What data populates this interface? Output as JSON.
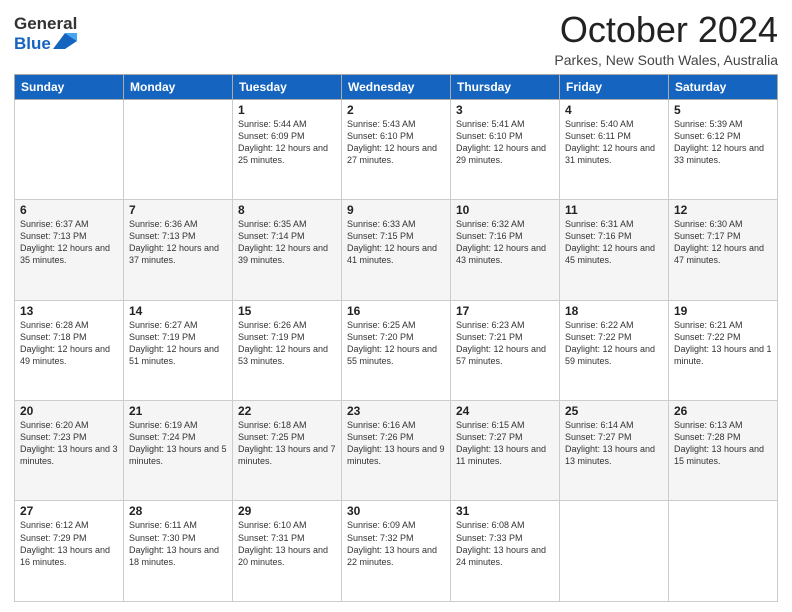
{
  "logo": {
    "general": "General",
    "blue": "Blue"
  },
  "title": {
    "month_year": "October 2024",
    "location": "Parkes, New South Wales, Australia"
  },
  "days_of_week": [
    "Sunday",
    "Monday",
    "Tuesday",
    "Wednesday",
    "Thursday",
    "Friday",
    "Saturday"
  ],
  "weeks": [
    [
      {
        "day": "",
        "info": ""
      },
      {
        "day": "",
        "info": ""
      },
      {
        "day": "1",
        "info": "Sunrise: 5:44 AM\nSunset: 6:09 PM\nDaylight: 12 hours and 25 minutes."
      },
      {
        "day": "2",
        "info": "Sunrise: 5:43 AM\nSunset: 6:10 PM\nDaylight: 12 hours and 27 minutes."
      },
      {
        "day": "3",
        "info": "Sunrise: 5:41 AM\nSunset: 6:10 PM\nDaylight: 12 hours and 29 minutes."
      },
      {
        "day": "4",
        "info": "Sunrise: 5:40 AM\nSunset: 6:11 PM\nDaylight: 12 hours and 31 minutes."
      },
      {
        "day": "5",
        "info": "Sunrise: 5:39 AM\nSunset: 6:12 PM\nDaylight: 12 hours and 33 minutes."
      }
    ],
    [
      {
        "day": "6",
        "info": "Sunrise: 6:37 AM\nSunset: 7:13 PM\nDaylight: 12 hours and 35 minutes."
      },
      {
        "day": "7",
        "info": "Sunrise: 6:36 AM\nSunset: 7:13 PM\nDaylight: 12 hours and 37 minutes."
      },
      {
        "day": "8",
        "info": "Sunrise: 6:35 AM\nSunset: 7:14 PM\nDaylight: 12 hours and 39 minutes."
      },
      {
        "day": "9",
        "info": "Sunrise: 6:33 AM\nSunset: 7:15 PM\nDaylight: 12 hours and 41 minutes."
      },
      {
        "day": "10",
        "info": "Sunrise: 6:32 AM\nSunset: 7:16 PM\nDaylight: 12 hours and 43 minutes."
      },
      {
        "day": "11",
        "info": "Sunrise: 6:31 AM\nSunset: 7:16 PM\nDaylight: 12 hours and 45 minutes."
      },
      {
        "day": "12",
        "info": "Sunrise: 6:30 AM\nSunset: 7:17 PM\nDaylight: 12 hours and 47 minutes."
      }
    ],
    [
      {
        "day": "13",
        "info": "Sunrise: 6:28 AM\nSunset: 7:18 PM\nDaylight: 12 hours and 49 minutes."
      },
      {
        "day": "14",
        "info": "Sunrise: 6:27 AM\nSunset: 7:19 PM\nDaylight: 12 hours and 51 minutes."
      },
      {
        "day": "15",
        "info": "Sunrise: 6:26 AM\nSunset: 7:19 PM\nDaylight: 12 hours and 53 minutes."
      },
      {
        "day": "16",
        "info": "Sunrise: 6:25 AM\nSunset: 7:20 PM\nDaylight: 12 hours and 55 minutes."
      },
      {
        "day": "17",
        "info": "Sunrise: 6:23 AM\nSunset: 7:21 PM\nDaylight: 12 hours and 57 minutes."
      },
      {
        "day": "18",
        "info": "Sunrise: 6:22 AM\nSunset: 7:22 PM\nDaylight: 12 hours and 59 minutes."
      },
      {
        "day": "19",
        "info": "Sunrise: 6:21 AM\nSunset: 7:22 PM\nDaylight: 13 hours and 1 minute."
      }
    ],
    [
      {
        "day": "20",
        "info": "Sunrise: 6:20 AM\nSunset: 7:23 PM\nDaylight: 13 hours and 3 minutes."
      },
      {
        "day": "21",
        "info": "Sunrise: 6:19 AM\nSunset: 7:24 PM\nDaylight: 13 hours and 5 minutes."
      },
      {
        "day": "22",
        "info": "Sunrise: 6:18 AM\nSunset: 7:25 PM\nDaylight: 13 hours and 7 minutes."
      },
      {
        "day": "23",
        "info": "Sunrise: 6:16 AM\nSunset: 7:26 PM\nDaylight: 13 hours and 9 minutes."
      },
      {
        "day": "24",
        "info": "Sunrise: 6:15 AM\nSunset: 7:27 PM\nDaylight: 13 hours and 11 minutes."
      },
      {
        "day": "25",
        "info": "Sunrise: 6:14 AM\nSunset: 7:27 PM\nDaylight: 13 hours and 13 minutes."
      },
      {
        "day": "26",
        "info": "Sunrise: 6:13 AM\nSunset: 7:28 PM\nDaylight: 13 hours and 15 minutes."
      }
    ],
    [
      {
        "day": "27",
        "info": "Sunrise: 6:12 AM\nSunset: 7:29 PM\nDaylight: 13 hours and 16 minutes."
      },
      {
        "day": "28",
        "info": "Sunrise: 6:11 AM\nSunset: 7:30 PM\nDaylight: 13 hours and 18 minutes."
      },
      {
        "day": "29",
        "info": "Sunrise: 6:10 AM\nSunset: 7:31 PM\nDaylight: 13 hours and 20 minutes."
      },
      {
        "day": "30",
        "info": "Sunrise: 6:09 AM\nSunset: 7:32 PM\nDaylight: 13 hours and 22 minutes."
      },
      {
        "day": "31",
        "info": "Sunrise: 6:08 AM\nSunset: 7:33 PM\nDaylight: 13 hours and 24 minutes."
      },
      {
        "day": "",
        "info": ""
      },
      {
        "day": "",
        "info": ""
      }
    ]
  ]
}
